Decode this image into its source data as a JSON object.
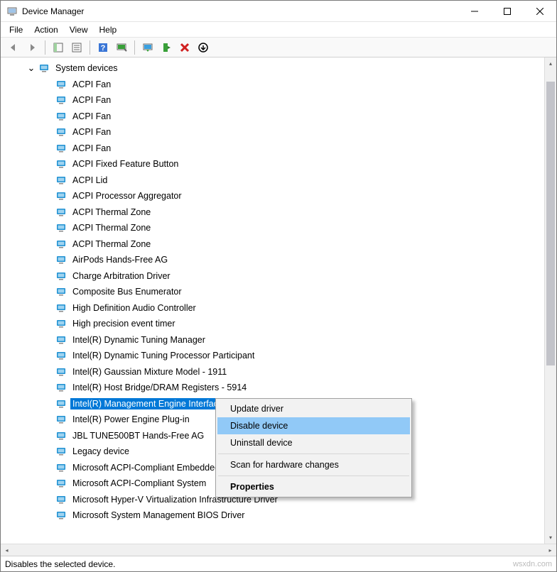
{
  "window": {
    "title": "Device Manager"
  },
  "menu": {
    "file": "File",
    "action": "Action",
    "view": "View",
    "help": "Help"
  },
  "tree": {
    "category": "System devices",
    "devices": [
      "ACPI Fan",
      "ACPI Fan",
      "ACPI Fan",
      "ACPI Fan",
      "ACPI Fan",
      "ACPI Fixed Feature Button",
      "ACPI Lid",
      "ACPI Processor Aggregator",
      "ACPI Thermal Zone",
      "ACPI Thermal Zone",
      "ACPI Thermal Zone",
      "AirPods Hands-Free AG",
      "Charge Arbitration Driver",
      "Composite Bus Enumerator",
      "High Definition Audio Controller",
      "High precision event timer",
      "Intel(R) Dynamic Tuning Manager",
      "Intel(R) Dynamic Tuning Processor Participant",
      "Intel(R) Gaussian Mixture Model - 1911",
      "Intel(R) Host Bridge/DRAM Registers - 5914",
      "Intel(R) Management Engine Interface",
      "Intel(R) Power Engine Plug-in",
      "JBL TUNE500BT Hands-Free AG",
      "Legacy device",
      "Microsoft ACPI-Compliant Embedded Controller",
      "Microsoft ACPI-Compliant System",
      "Microsoft Hyper-V Virtualization Infrastructure Driver",
      "Microsoft System Management BIOS Driver"
    ],
    "selected_index": 20
  },
  "context_menu": {
    "update": "Update driver",
    "disable": "Disable device",
    "uninstall": "Uninstall device",
    "scan": "Scan for hardware changes",
    "properties": "Properties",
    "highlighted": "disable"
  },
  "status": "Disables the selected device.",
  "watermark": "wsxdn.com"
}
